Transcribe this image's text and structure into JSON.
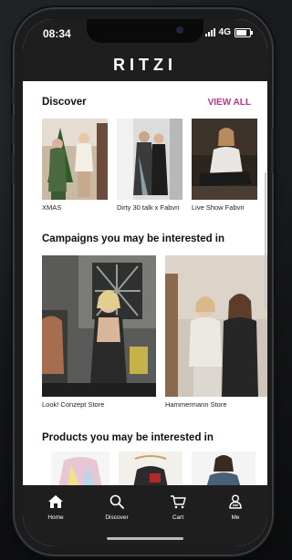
{
  "status_bar": {
    "time": "08:34",
    "network": "4G"
  },
  "app": {
    "logo": "RITZI"
  },
  "discover": {
    "title": "Discover",
    "view_all": "VIEW ALL",
    "items": [
      {
        "caption": "XMAS"
      },
      {
        "caption": "Dirty 30 talk x Fabvri"
      },
      {
        "caption": "Live Show Fabvri"
      }
    ]
  },
  "campaigns": {
    "title": "Campaigns you may be interested in",
    "items": [
      {
        "caption": "Look! Conzept Store"
      },
      {
        "caption": "Hammermann Store"
      }
    ]
  },
  "products": {
    "title": "Products you may be interested in"
  },
  "tabbar": {
    "items": [
      {
        "label": "Home",
        "icon": "home-icon"
      },
      {
        "label": "Discover",
        "icon": "search-icon"
      },
      {
        "label": "Cart",
        "icon": "cart-icon"
      },
      {
        "label": "Me",
        "icon": "user-icon"
      }
    ]
  },
  "colors": {
    "accent": "#c2338a",
    "bar": "#1e1e1e"
  }
}
